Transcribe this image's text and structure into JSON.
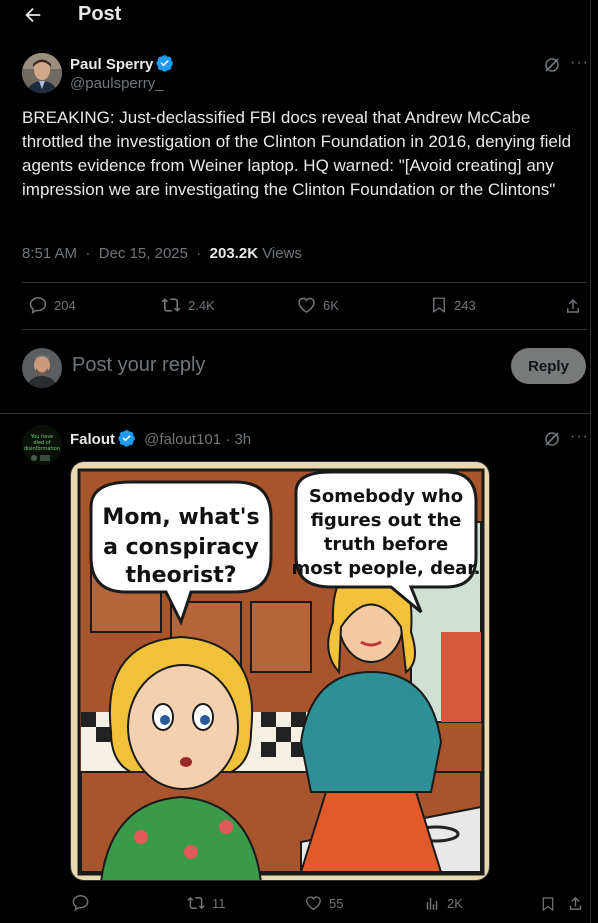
{
  "header": {
    "title": "Post"
  },
  "main_post": {
    "author_name": "Paul Sperry",
    "author_handle": "@paulsperry_",
    "text": "BREAKING: Just-declassified FBI docs reveal that Andrew McCabe throttled the investigation of the Clinton Foundation in 2016, denying field agents evidence from Weiner laptop. HQ warned: \"[Avoid creating] any impression we are investigating the Clinton Foundation or the Clintons\"",
    "time": "8:51 AM",
    "date": "Dec 15, 2025",
    "views": "203.2K",
    "views_label": "Views",
    "stats": {
      "replies": "204",
      "reposts": "2.4K",
      "likes": "6K",
      "bookmarks": "243"
    }
  },
  "composer": {
    "placeholder": "Post your reply",
    "button_label": "Reply"
  },
  "reply_post": {
    "author_name": "Falout",
    "author_handle": "@falout101",
    "time": "3h",
    "avatar_text": "You have died of disinformation",
    "image": {
      "bubble_left": "Mom, what's a conspiracy theorist?",
      "bubble_right": "Somebody who figures out the truth before most people, dear."
    },
    "stats": {
      "replies": "",
      "reposts": "11",
      "likes": "55",
      "views": "2K"
    }
  },
  "colors": {
    "accent": "#1d9bf0",
    "muted": "#71767b",
    "text": "#e7e9ea",
    "border": "#2f3336"
  },
  "icons": [
    "back-arrow-icon",
    "verified-badge-icon",
    "grok-icon",
    "more-icon",
    "reply-icon",
    "repost-icon",
    "like-icon",
    "bookmark-icon",
    "share-icon",
    "views-icon"
  ]
}
